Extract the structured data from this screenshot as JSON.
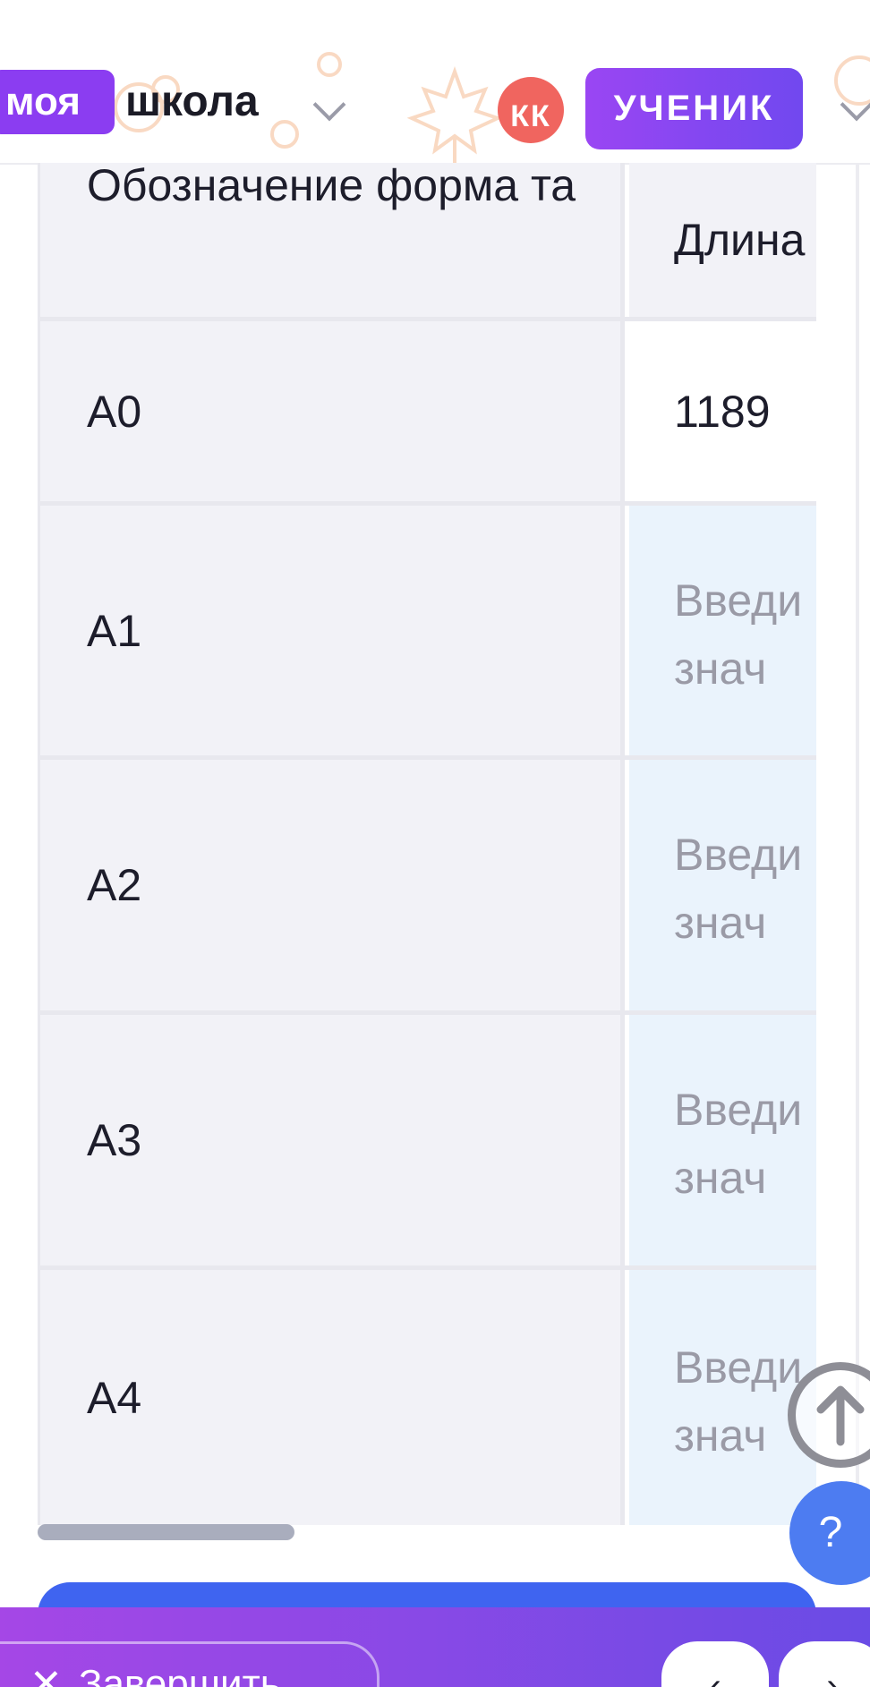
{
  "header": {
    "logo_box": "моя",
    "logo_text": "школа",
    "avatar_initials": "КК",
    "role_label": "УЧЕНИК"
  },
  "table": {
    "col_format_header": "Обозначение форма та",
    "col_length_header": "Длина",
    "rows": [
      {
        "format": "A0",
        "length": "1189"
      },
      {
        "format": "A1",
        "placeholder": "Введи е знач"
      },
      {
        "format": "A2",
        "placeholder": "Введи е знач"
      },
      {
        "format": "A3",
        "placeholder": "Введи е знач"
      },
      {
        "format": "A4",
        "placeholder": "Введи е знач"
      }
    ]
  },
  "help_label": "?",
  "bottom_bar": {
    "finish_label": "Завершить",
    "prev_icon": "chevron-left-icon",
    "next_icon": "chevron-right-icon"
  },
  "colors": {
    "accent_purple": "#8b3df1",
    "avatar_red": "#f0655f",
    "help_blue": "#4d7cf1",
    "input_bg": "#eaf3fc"
  }
}
